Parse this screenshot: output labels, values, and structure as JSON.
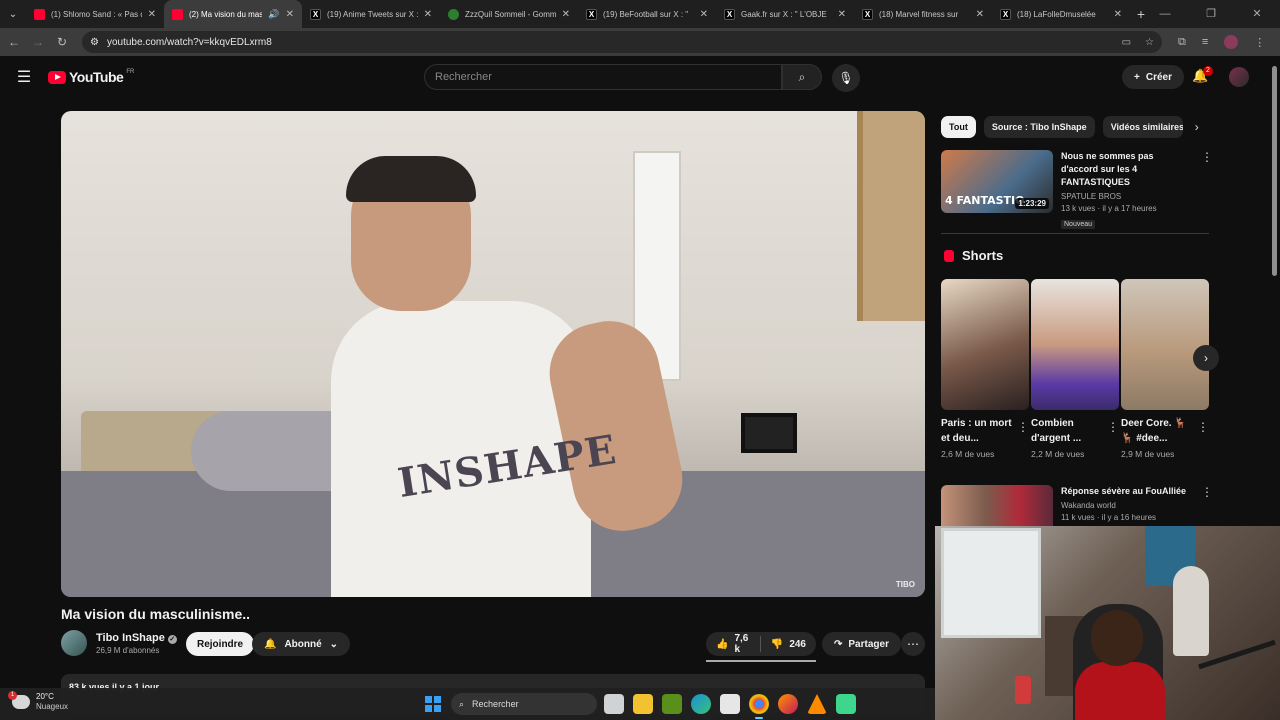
{
  "browser": {
    "tabs": [
      {
        "label": "(1) Shlomo Sand : « Pas d",
        "favicon": "youtube-icon",
        "active": false
      },
      {
        "label": "(2) Ma vision du masc",
        "favicon": "youtube-icon",
        "active": true
      },
      {
        "label": "(19) Anime Tweets sur X :",
        "favicon": "x-icon",
        "active": false
      },
      {
        "label": "ZzzQuil Sommeil - Gomm",
        "favicon": "zzzquil-icon",
        "active": false
      },
      {
        "label": "(19) BeFootball sur X : \"",
        "favicon": "x-icon",
        "active": false
      },
      {
        "label": "Gaak.fr sur X : \" L'OBJE",
        "favicon": "x-icon",
        "active": false
      },
      {
        "label": "(18) Marvel fitness sur",
        "favicon": "x-icon",
        "active": false
      },
      {
        "label": "(18) LaFolleDmuselée",
        "favicon": "x-icon",
        "active": false
      }
    ],
    "url": "youtube.com/watch?v=kkqvEDLxrm8"
  },
  "youtube": {
    "logo_text": "YouTube",
    "country": "FR",
    "search_placeholder": "Rechercher",
    "create_label": "Créer",
    "notif_count": "2"
  },
  "video": {
    "title": "Ma vision du masculinisme..",
    "shirt_text": "INSHAPE",
    "watermark": "TIBO",
    "channel": "Tibo InShape",
    "subscribers": "26,9 M d'abonnés",
    "join_label": "Rejoindre",
    "subscribed_label": "Abonné",
    "likes": "7,6 k",
    "dislikes": "246",
    "share_label": "Partager",
    "description_meta": "83 k vues  il y a 1 jour"
  },
  "sidebar": {
    "chips": [
      "Tout",
      "Source : Tibo InShape",
      "Vidéos similaires"
    ],
    "recs": [
      {
        "title": "Nous ne sommes pas d'accord sur les 4 FANTASTIQUES",
        "channel": "SPATULE BROS",
        "meta": "13 k vues · il y a 17 heures",
        "duration": "1:23:29",
        "badge": "Nouveau",
        "thumb_text": "4 FANTASTIQ"
      },
      {
        "title": "Réponse sévère au FouAlliée",
        "channel": "Wakanda world",
        "meta": "11 k vues · il y a 16 heures"
      }
    ],
    "shorts_label": "Shorts",
    "shorts": [
      {
        "title": "Paris : un mort et deu...",
        "views": "2,6 M de vues"
      },
      {
        "title": "Combien d'argent ...",
        "views": "2,2 M de vues"
      },
      {
        "title": "Deer Core. 🦌🦌 #dee...",
        "views": "2,9 M de vues"
      }
    ]
  },
  "taskbar": {
    "temperature": "20°C",
    "weather": "Nuageux",
    "weather_badge": "1",
    "search_placeholder": "Rechercher"
  },
  "colors": {
    "accent": "#ff0033",
    "background": "#0f0f0f",
    "surface": "#272727"
  }
}
